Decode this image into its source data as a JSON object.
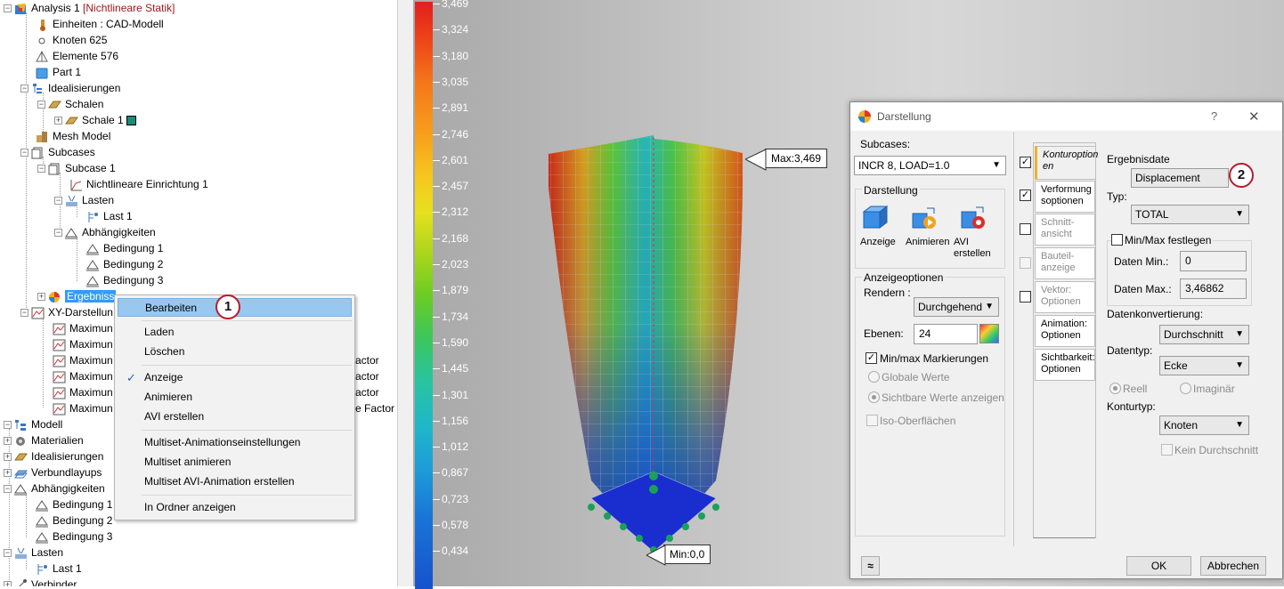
{
  "tree": {
    "rows": [
      {
        "label": "Analysis 1",
        "suffix": "[Nichtlineare Statik]"
      },
      {
        "label": "Einheiten : CAD-Modell"
      },
      {
        "label": "Knoten 625"
      },
      {
        "label": "Elemente 576"
      },
      {
        "label": "Part 1"
      },
      {
        "label": "Idealisierungen"
      },
      {
        "label": "Schalen"
      },
      {
        "label": "Schale 1"
      },
      {
        "label": "Mesh Model"
      },
      {
        "label": "Subcases"
      },
      {
        "label": "Subcase 1"
      },
      {
        "label": "Nichtlineare Einrichtung 1"
      },
      {
        "label": "Lasten"
      },
      {
        "label": "Last 1"
      },
      {
        "label": "Abhängigkeiten"
      },
      {
        "label": "Bedingung 1"
      },
      {
        "label": "Bedingung 2"
      },
      {
        "label": "Bedingung 3"
      },
      {
        "label": "Ergebniss"
      },
      {
        "label": "XY-Darstellun"
      },
      {
        "label": "Maximun"
      },
      {
        "label": "Maximun"
      },
      {
        "label": "Maximun",
        "tail": "actor"
      },
      {
        "label": "Maximun",
        "tail": "actor"
      },
      {
        "label": "Maximun",
        "tail": "actor"
      },
      {
        "label": "Maximun",
        "tail": "e Factor"
      },
      {
        "label": "Modell"
      },
      {
        "label": "Materialien"
      },
      {
        "label": "Idealisierungen"
      },
      {
        "label": "Verbundlayups"
      },
      {
        "label": "Abhängigkeiten"
      },
      {
        "label": "Bedingung 1"
      },
      {
        "label": "Bedingung 2"
      },
      {
        "label": "Bedingung 3"
      },
      {
        "label": "Lasten"
      },
      {
        "label": "Last 1"
      },
      {
        "label": "Verbinder"
      }
    ]
  },
  "context_menu": {
    "items": [
      "Bearbeiten",
      "Laden",
      "Löschen",
      "Anzeige",
      "Animieren",
      "AVI erstellen",
      "Multiset-Animationseinstellungen",
      "Multiset animieren",
      "Multiset AVI-Animation erstellen",
      "In Ordner anzeigen"
    ],
    "badge": "1"
  },
  "legend": {
    "values": [
      "3,469",
      "3,324",
      "3,180",
      "3,035",
      "2,891",
      "2,746",
      "2,601",
      "2,457",
      "2,312",
      "2,168",
      "2,023",
      "1,879",
      "1,734",
      "1,590",
      "1,445",
      "1,301",
      "1,156",
      "1,012",
      "0,867",
      "0,723",
      "0,578",
      "0,434"
    ]
  },
  "viewport": {
    "max_label": "Max:3,469",
    "min_label": "Min:0,0"
  },
  "dialog": {
    "title": "Darstellung",
    "help": "?",
    "close": "✕",
    "subcases_label": "Subcases:",
    "subcase_value": "INCR 8, LOAD=1.0",
    "darstellung_label": "Darstellung",
    "anzeige": "Anzeige",
    "animieren": "Animieren",
    "avi_line1": "AVI",
    "avi_line2": "erstellen",
    "anzeigeoptionen": "Anzeigeoptionen",
    "rendern_label": "Rendern :",
    "rendern_value": "Durchgehend",
    "ebenen_label": "Ebenen:",
    "ebenen_value": "24",
    "minmax_markierungen": "Min/max Markierungen",
    "globale_werte": "Globale Werte",
    "sichtbare_werte": "Sichtbare Werte anzeigen",
    "iso_oberflaechen": "Iso-Oberflächen",
    "tabs": [
      {
        "line1": "Konturoption",
        "line2": "en"
      },
      {
        "line1": "Verformung",
        "line2": "soptionen"
      },
      {
        "line1": "Schnitt-",
        "line2": "ansicht"
      },
      {
        "line1": "Bauteil-",
        "line2": "anzeige"
      },
      {
        "line1": "Vektor:",
        "line2": "Optionen"
      },
      {
        "line1": "Animation:",
        "line2": "Optionen"
      },
      {
        "line1": "Sichtbarkeit:",
        "line2": "Optionen"
      }
    ],
    "ergebnisdatei_label": "Ergebnisdate",
    "ergebnis_value": "Displacement",
    "badge2": "2",
    "typ_label": "Typ:",
    "typ_value": "TOTAL",
    "minmax_festlegen": "Min/Max festlegen",
    "daten_min_label": "Daten Min.:",
    "daten_min_value": "0",
    "daten_max_label": "Daten Max.:",
    "daten_max_value": "3,46862",
    "datenkonvertierung_label": "Datenkonvertierung:",
    "datenkonvertierung_value": "Durchschnitt",
    "datentyp_label": "Datentyp:",
    "datentyp_value": "Ecke",
    "reell": "Reell",
    "imaginaer": "Imaginär",
    "konturtyp_label": "Konturtyp:",
    "konturtyp_value": "Knoten",
    "kein_durchschnitt": "Kein Durchschnitt",
    "ok": "OK",
    "abbrechen": "Abbrechen",
    "collapse": "≈"
  }
}
